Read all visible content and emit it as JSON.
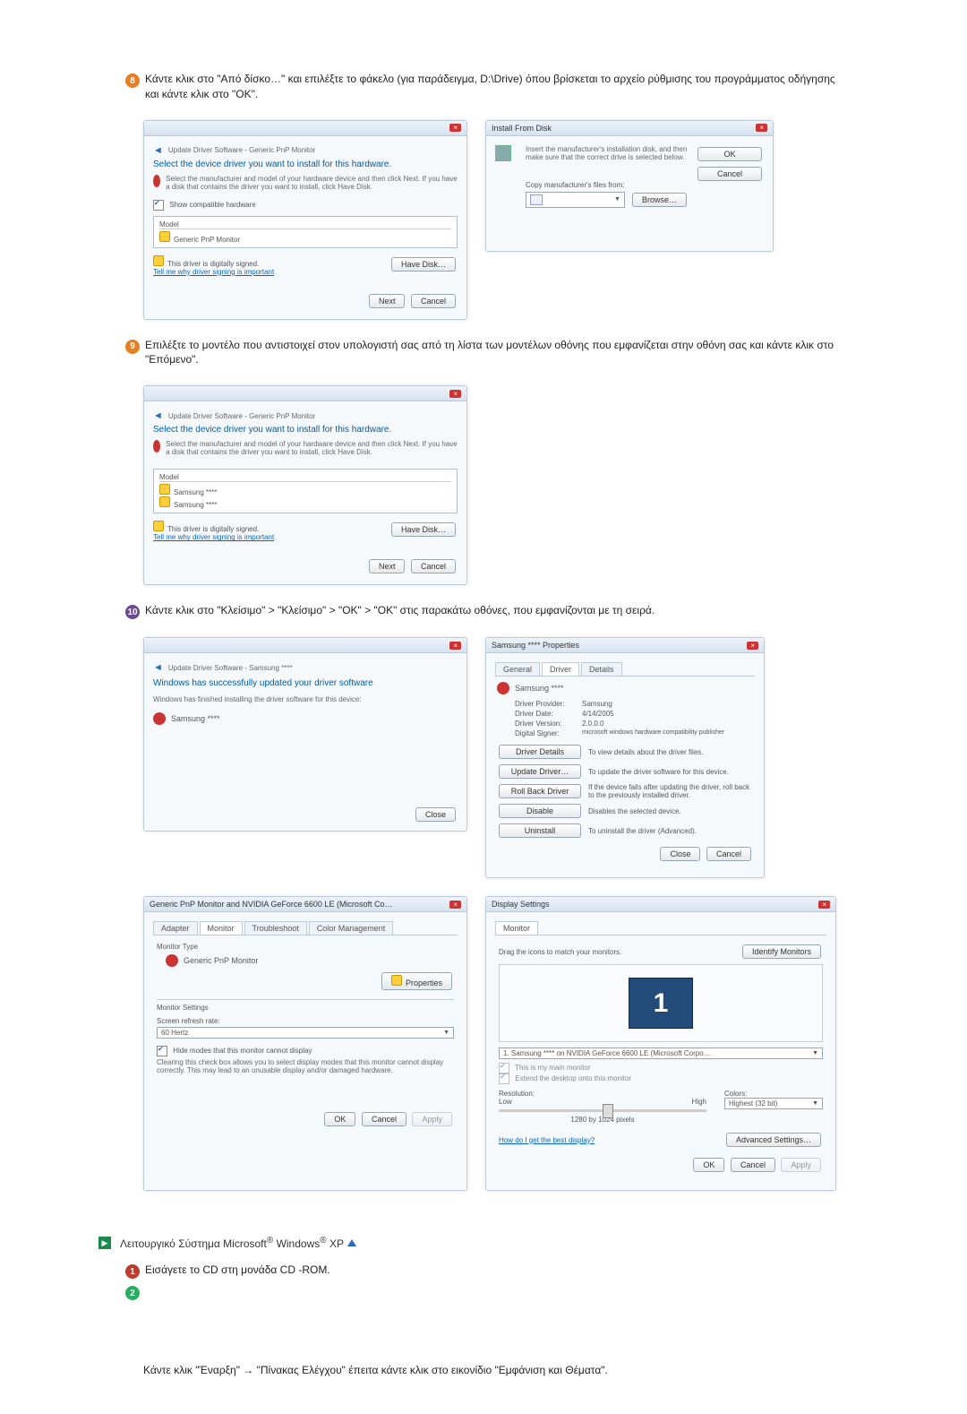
{
  "step8": {
    "text": "Κάντε κλικ στο \"Από δίσκο…\" και επιλέξτε το φάκελο (για παράδειγμα, D:\\Drive) όπου βρίσκεται το αρχείο ρύθμισης του προγράμματος οδήγησης και κάντε κλικ στο \"OK\"."
  },
  "dlg1": {
    "title": "Update Driver Software - Generic PnP Monitor",
    "heading": "Select the device driver you want to install for this hardware.",
    "sub": "Select the manufacturer and model of your hardware device and then click Next. If you have a disk that contains the driver you want to install, click Have Disk.",
    "showCompat": "Show compatible hardware",
    "colModel": "Model",
    "item1": "Generic PnP Monitor",
    "signed": "This driver is digitally signed.",
    "tell": "Tell me why driver signing is important",
    "haveDisk": "Have Disk…",
    "next": "Next",
    "cancel": "Cancel"
  },
  "dlg2": {
    "title": "Install From Disk",
    "msg": "Insert the manufacturer's installation disk, and then make sure that the correct drive is selected below.",
    "ok": "OK",
    "cancel": "Cancel",
    "copyLabel": "Copy manufacturer's files from:",
    "browse": "Browse…"
  },
  "step9": {
    "text": "Επιλέξτε το μοντέλο που αντιστοιχεί στον υπολογιστή σας από τη λίστα των μοντέλων οθόνης που εμφανίζεται στην οθόνη σας και κάντε κλικ στο \"Επόμενο\"."
  },
  "dlg3": {
    "title": "Update Driver Software - Generic PnP Monitor",
    "heading": "Select the device driver you want to install for this hardware.",
    "sub": "Select the manufacturer and model of your hardware device and then click Next. If you have a disk that contains the driver you want to install, click Have Disk.",
    "colModel": "Model",
    "item1": "Samsung ****",
    "item2": "Samsung ****",
    "signed": "This driver is digitally signed.",
    "tell": "Tell me why driver signing is important",
    "haveDisk": "Have Disk…",
    "next": "Next",
    "cancel": "Cancel"
  },
  "step10": {
    "text": "Κάντε κλικ στο \"Κλείσιμο\" > \"Κλείσιμο\" > \"OK\" > \"OK\" στις παρακάτω οθόνες, που εμφανίζονται με τη σειρά."
  },
  "dlg4": {
    "title": "Update Driver Software - Samsung ****",
    "heading": "Windows has successfully updated your driver software",
    "sub": "Windows has finished installing the driver software for this device:",
    "name": "Samsung ****",
    "close": "Close"
  },
  "dlg5": {
    "title": "Samsung **** Properties",
    "tab1": "General",
    "tab2": "Driver",
    "tab3": "Details",
    "name": "Samsung ****",
    "r1l": "Driver Provider:",
    "r1v": "Samsung",
    "r2l": "Driver Date:",
    "r2v": "4/14/2005",
    "r3l": "Driver Version:",
    "r3v": "2.0.0.0",
    "r4l": "Digital Signer:",
    "r4v": "microsoft windows hardware compatibility publisher",
    "b1": "Driver Details",
    "b1t": "To view details about the driver files.",
    "b2": "Update Driver…",
    "b2t": "To update the driver software for this device.",
    "b3": "Roll Back Driver",
    "b3t": "If the device fails after updating the driver, roll back to the previously installed driver.",
    "b4": "Disable",
    "b4t": "Disables the selected device.",
    "b5": "Uninstall",
    "b5t": "To uninstall the driver (Advanced).",
    "close": "Close",
    "cancel": "Cancel"
  },
  "dlg6": {
    "title": "Generic PnP Monitor and NVIDIA GeForce 6600 LE (Microsoft Co…",
    "tabs": [
      "Adapter",
      "Monitor",
      "Troubleshoot",
      "Color Management"
    ],
    "mtLabel": "Monitor Type",
    "mtVal": "Generic PnP Monitor",
    "propBtn": "Properties",
    "msHead": "Monitor Settings",
    "refreshLbl": "Screen refresh rate:",
    "refreshVal": "60 Hertz",
    "hideLbl": "Hide modes that this monitor cannot display",
    "hideDesc": "Clearing this check box allows you to select display modes that this monitor cannot display correctly. This may lead to an unusable display and/or damaged hardware.",
    "ok": "OK",
    "cancel": "Cancel",
    "apply": "Apply"
  },
  "dlg7": {
    "title": "Display Settings",
    "tab": "Monitor",
    "drag": "Drag the icons to match your monitors.",
    "identify": "Identify Monitors",
    "ddVal": "1. Samsung **** on NVIDIA GeForce 6600 LE (Microsoft Corpo…",
    "mainChk": "This is my main monitor",
    "extChk": "Extend the desktop onto this monitor",
    "resHead": "Resolution:",
    "low": "Low",
    "high": "High",
    "resVal": "1280 by 1024 pixels",
    "colHead": "Colors:",
    "colVal": "Highest (32 bit)",
    "bestLink": "How do I get the best display?",
    "advBtn": "Advanced Settings…",
    "ok": "OK",
    "cancel": "Cancel",
    "apply": "Apply"
  },
  "xp": {
    "title_prefix": "Λειτουργικό Σύστημα Microsoft",
    "title_mid": " Windows",
    "title_suffix": " XP",
    "step1": "Εισάγετε το CD στη μονάδα CD -ROM.",
    "step2": "Κάντε κλικ \"Έναρξη\" → \"Πίνακας Ελέγχου\" έπειτα κάντε κλικ στο εικονίδιο \"Εμφάνιση και Θέματα\"."
  }
}
